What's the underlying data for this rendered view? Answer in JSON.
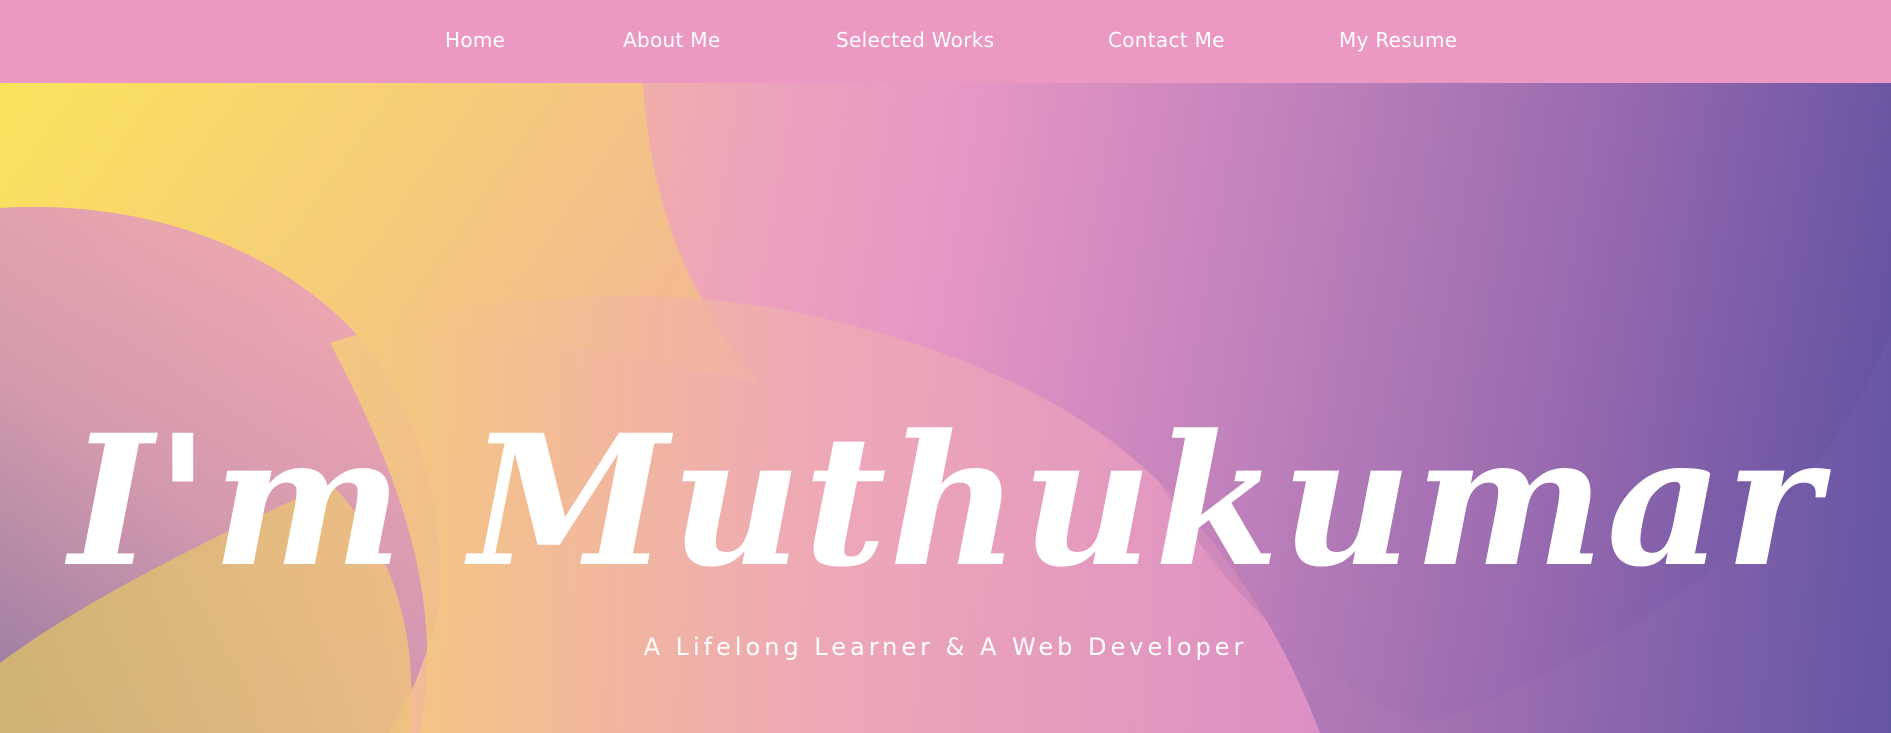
{
  "navbar": {
    "items": [
      {
        "label": "Home"
      },
      {
        "label": "About Me"
      },
      {
        "label": "Selected Works"
      },
      {
        "label": "Contact Me"
      },
      {
        "label": "My Resume"
      }
    ]
  },
  "hero": {
    "title": "I'm Muthukumar",
    "subtitle": "A Lifelong Learner & A Web Developer"
  },
  "colors": {
    "navbar_bg": "#eb98c2",
    "gradient_start": "#f9e05e",
    "gradient_mid": "#e897c5",
    "gradient_end": "#5a4ea0",
    "text": "#ffffff"
  }
}
